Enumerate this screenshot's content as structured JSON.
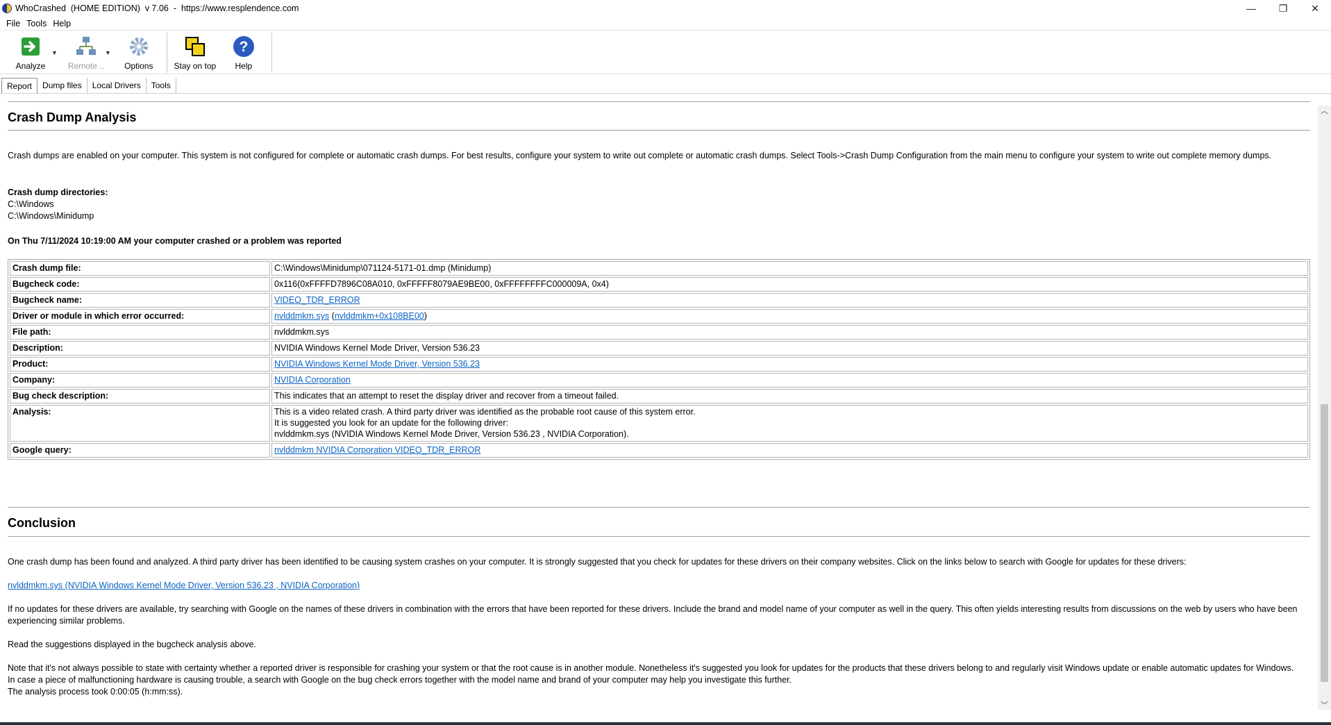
{
  "window": {
    "title": "WhoCrashed  (HOME EDITION)  v 7.06  -  https://www.resplendence.com",
    "minimize": "—",
    "restore": "❐",
    "close": "✕"
  },
  "menu": {
    "file": "File",
    "tools": "Tools",
    "help": "Help"
  },
  "toolbar": {
    "analyze": "Analyze",
    "remote": "Remote ..",
    "options": "Options",
    "stay_on_top": "Stay on top",
    "help": "Help"
  },
  "tabs": [
    "Report",
    "Dump files",
    "Local Drivers",
    "Tools"
  ],
  "report": {
    "heading": "Crash Dump Analysis",
    "intro": "Crash dumps are enabled on your computer. This system is not configured for complete or automatic crash dumps. For best results, configure your system to write out complete or automatic crash dumps. Select Tools->Crash Dump Configuration from the main menu to configure your system to write out complete memory dumps.",
    "dirs_label": "Crash dump directories:",
    "dir1": "C:\\Windows",
    "dir2": "C:\\Windows\\Minidump",
    "crash_line": "On Thu 7/11/2024 10:19:00 AM your computer crashed or a problem was reported",
    "rows": [
      {
        "label": "Crash dump file:",
        "value": "C:\\Windows\\Minidump\\071124-5171-01.dmp (Minidump)"
      },
      {
        "label": "Bugcheck code:",
        "value": "0x116(0xFFFFD7896C08A010, 0xFFFFF8079AE9BE00, 0xFFFFFFFFC000009A, 0x4)"
      },
      {
        "label": "Bugcheck name:",
        "value": "VIDEO_TDR_ERROR"
      },
      {
        "label": "Driver or module in which error occurred:",
        "value": "nvlddmkm.sys",
        "value_mid": " (",
        "value2": "nvlddmkm+0x108BE00",
        "value_end": ")"
      },
      {
        "label": "File path:",
        "value": "nvlddmkm.sys"
      },
      {
        "label": "Description:",
        "value": "NVIDIA Windows Kernel Mode Driver, Version 536.23"
      },
      {
        "label": "Product:",
        "value": "NVIDIA Windows Kernel Mode Driver, Version 536.23"
      },
      {
        "label": "Company:",
        "value": "NVIDIA Corporation"
      },
      {
        "label": "Bug check description:",
        "value": "This indicates that an attempt to reset the display driver and recover from a timeout failed."
      },
      {
        "label": "Analysis:",
        "line1": "This is a video related crash. A third party driver was identified as the probable root cause of this system error.",
        "line2": "It is suggested you look for an update for the following driver:",
        "line3": "nvlddmkm.sys (NVIDIA Windows Kernel Mode Driver, Version 536.23 , NVIDIA Corporation)."
      },
      {
        "label": "Google query:",
        "value": "nvlddmkm NVIDIA Corporation VIDEO_TDR_ERROR"
      }
    ]
  },
  "conclusion": {
    "heading": "Conclusion",
    "p1": "One crash dump has been found and analyzed. A third party driver has been identified to be causing system crashes on your computer. It is strongly suggested that you check for updates for these drivers on their company websites. Click on the links below to search with Google for updates for these drivers:",
    "link": "nvlddmkm.sys (NVIDIA Windows Kernel Mode Driver, Version 536.23 , NVIDIA Corporation)",
    "p2": "If no updates for these drivers are available, try searching with Google on the names of these drivers in combination with the errors that have been reported for these drivers. Include the brand and model name of your computer as well in the query. This often yields interesting results from discussions on the web by users who have been experiencing similar problems.",
    "p3": "Read the suggestions displayed in the bugcheck analysis above.",
    "p4": "Note that it's not always possible to state with certainty whether a reported driver is responsible for crashing your system or that the root cause is in another module. Nonetheless it's suggested you look for updates for the products that these drivers belong to and regularly visit Windows update or enable automatic updates for Windows. In case a piece of malfunctioning hardware is causing trouble, a search with Google on the bug check errors together with the model name and brand of your computer may help you investigate this further.",
    "p5": "The analysis process took 0:00:05 (h:mm:ss)."
  },
  "colors": {
    "link": "#0b63c4",
    "analyze_green": "#2e9e3a",
    "help_blue": "#2a5bbf"
  }
}
